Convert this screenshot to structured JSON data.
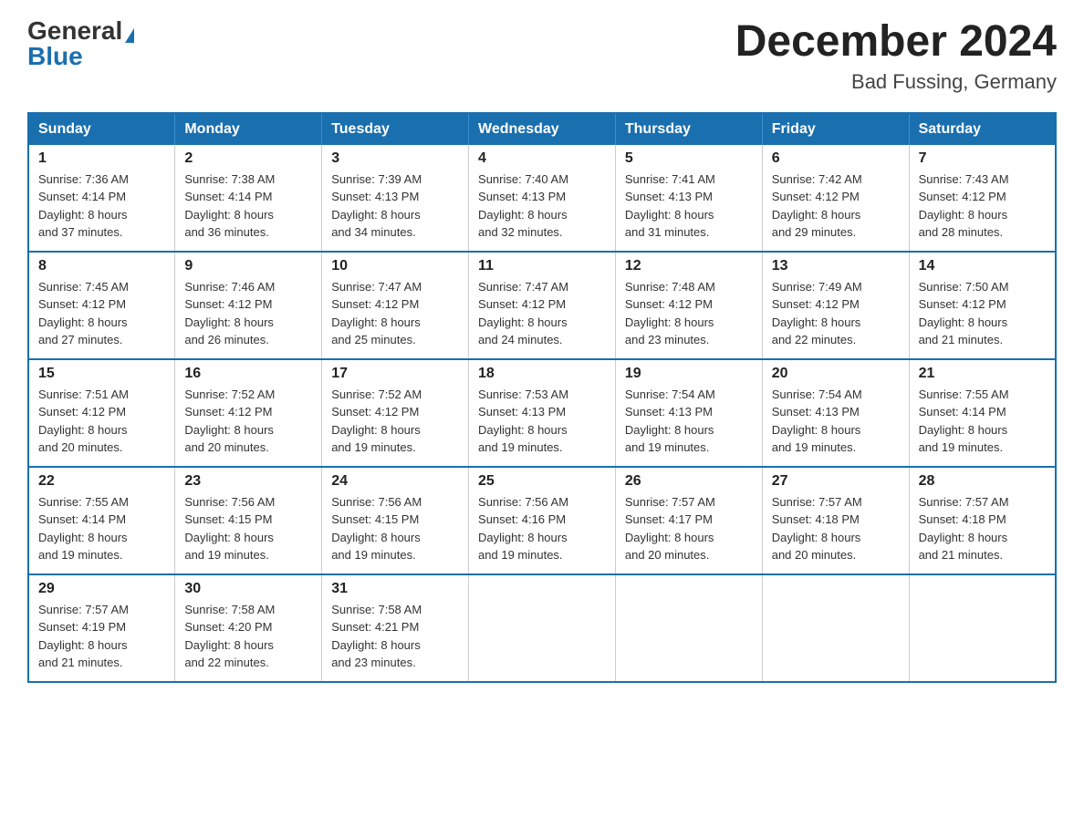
{
  "header": {
    "logo_general": "General",
    "logo_blue": "Blue",
    "month_title": "December 2024",
    "location": "Bad Fussing, Germany"
  },
  "days_of_week": [
    "Sunday",
    "Monday",
    "Tuesday",
    "Wednesday",
    "Thursday",
    "Friday",
    "Saturday"
  ],
  "weeks": [
    [
      {
        "day": "1",
        "sunrise": "7:36 AM",
        "sunset": "4:14 PM",
        "daylight": "8 hours and 37 minutes."
      },
      {
        "day": "2",
        "sunrise": "7:38 AM",
        "sunset": "4:14 PM",
        "daylight": "8 hours and 36 minutes."
      },
      {
        "day": "3",
        "sunrise": "7:39 AM",
        "sunset": "4:13 PM",
        "daylight": "8 hours and 34 minutes."
      },
      {
        "day": "4",
        "sunrise": "7:40 AM",
        "sunset": "4:13 PM",
        "daylight": "8 hours and 32 minutes."
      },
      {
        "day": "5",
        "sunrise": "7:41 AM",
        "sunset": "4:13 PM",
        "daylight": "8 hours and 31 minutes."
      },
      {
        "day": "6",
        "sunrise": "7:42 AM",
        "sunset": "4:12 PM",
        "daylight": "8 hours and 29 minutes."
      },
      {
        "day": "7",
        "sunrise": "7:43 AM",
        "sunset": "4:12 PM",
        "daylight": "8 hours and 28 minutes."
      }
    ],
    [
      {
        "day": "8",
        "sunrise": "7:45 AM",
        "sunset": "4:12 PM",
        "daylight": "8 hours and 27 minutes."
      },
      {
        "day": "9",
        "sunrise": "7:46 AM",
        "sunset": "4:12 PM",
        "daylight": "8 hours and 26 minutes."
      },
      {
        "day": "10",
        "sunrise": "7:47 AM",
        "sunset": "4:12 PM",
        "daylight": "8 hours and 25 minutes."
      },
      {
        "day": "11",
        "sunrise": "7:47 AM",
        "sunset": "4:12 PM",
        "daylight": "8 hours and 24 minutes."
      },
      {
        "day": "12",
        "sunrise": "7:48 AM",
        "sunset": "4:12 PM",
        "daylight": "8 hours and 23 minutes."
      },
      {
        "day": "13",
        "sunrise": "7:49 AM",
        "sunset": "4:12 PM",
        "daylight": "8 hours and 22 minutes."
      },
      {
        "day": "14",
        "sunrise": "7:50 AM",
        "sunset": "4:12 PM",
        "daylight": "8 hours and 21 minutes."
      }
    ],
    [
      {
        "day": "15",
        "sunrise": "7:51 AM",
        "sunset": "4:12 PM",
        "daylight": "8 hours and 20 minutes."
      },
      {
        "day": "16",
        "sunrise": "7:52 AM",
        "sunset": "4:12 PM",
        "daylight": "8 hours and 20 minutes."
      },
      {
        "day": "17",
        "sunrise": "7:52 AM",
        "sunset": "4:12 PM",
        "daylight": "8 hours and 19 minutes."
      },
      {
        "day": "18",
        "sunrise": "7:53 AM",
        "sunset": "4:13 PM",
        "daylight": "8 hours and 19 minutes."
      },
      {
        "day": "19",
        "sunrise": "7:54 AM",
        "sunset": "4:13 PM",
        "daylight": "8 hours and 19 minutes."
      },
      {
        "day": "20",
        "sunrise": "7:54 AM",
        "sunset": "4:13 PM",
        "daylight": "8 hours and 19 minutes."
      },
      {
        "day": "21",
        "sunrise": "7:55 AM",
        "sunset": "4:14 PM",
        "daylight": "8 hours and 19 minutes."
      }
    ],
    [
      {
        "day": "22",
        "sunrise": "7:55 AM",
        "sunset": "4:14 PM",
        "daylight": "8 hours and 19 minutes."
      },
      {
        "day": "23",
        "sunrise": "7:56 AM",
        "sunset": "4:15 PM",
        "daylight": "8 hours and 19 minutes."
      },
      {
        "day": "24",
        "sunrise": "7:56 AM",
        "sunset": "4:15 PM",
        "daylight": "8 hours and 19 minutes."
      },
      {
        "day": "25",
        "sunrise": "7:56 AM",
        "sunset": "4:16 PM",
        "daylight": "8 hours and 19 minutes."
      },
      {
        "day": "26",
        "sunrise": "7:57 AM",
        "sunset": "4:17 PM",
        "daylight": "8 hours and 20 minutes."
      },
      {
        "day": "27",
        "sunrise": "7:57 AM",
        "sunset": "4:18 PM",
        "daylight": "8 hours and 20 minutes."
      },
      {
        "day": "28",
        "sunrise": "7:57 AM",
        "sunset": "4:18 PM",
        "daylight": "8 hours and 21 minutes."
      }
    ],
    [
      {
        "day": "29",
        "sunrise": "7:57 AM",
        "sunset": "4:19 PM",
        "daylight": "8 hours and 21 minutes."
      },
      {
        "day": "30",
        "sunrise": "7:58 AM",
        "sunset": "4:20 PM",
        "daylight": "8 hours and 22 minutes."
      },
      {
        "day": "31",
        "sunrise": "7:58 AM",
        "sunset": "4:21 PM",
        "daylight": "8 hours and 23 minutes."
      },
      null,
      null,
      null,
      null
    ]
  ],
  "labels": {
    "sunrise": "Sunrise:",
    "sunset": "Sunset:",
    "daylight": "Daylight:"
  }
}
